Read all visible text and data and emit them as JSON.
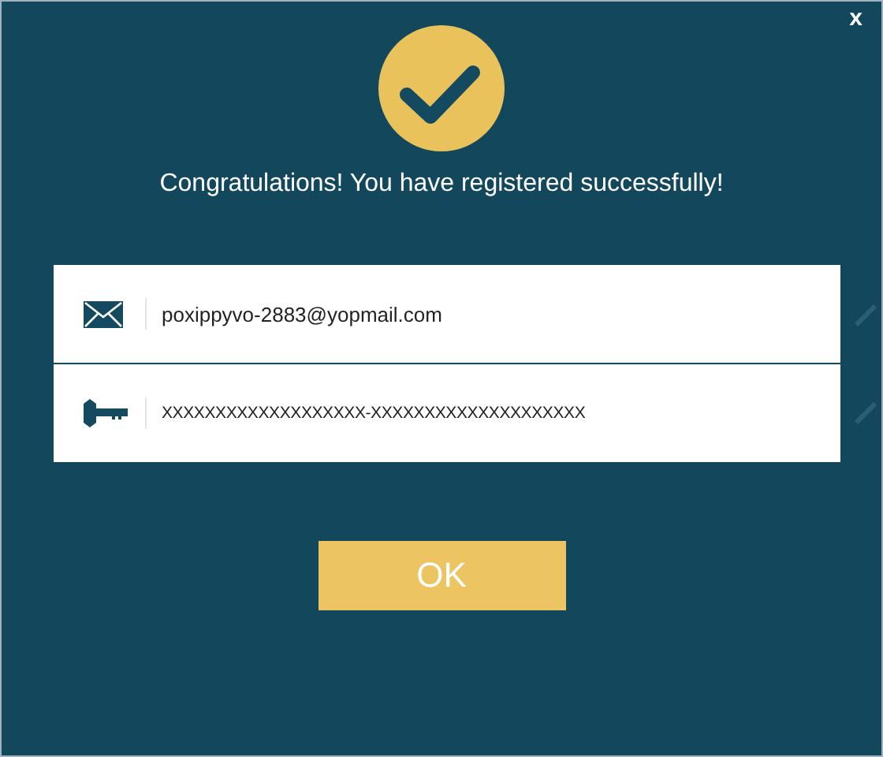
{
  "close_button": {
    "label": "x"
  },
  "message": "Congratulations! You have registered successfully!",
  "fields": [
    {
      "kind": "email",
      "value": "poxippyvo-2883@yopmail.com"
    },
    {
      "kind": "key",
      "value": "XXXXXXXXXXXXXXXXXXX-XXXXXXXXXXXXXXXXXXXX"
    }
  ],
  "ok_button": {
    "label": "OK"
  }
}
